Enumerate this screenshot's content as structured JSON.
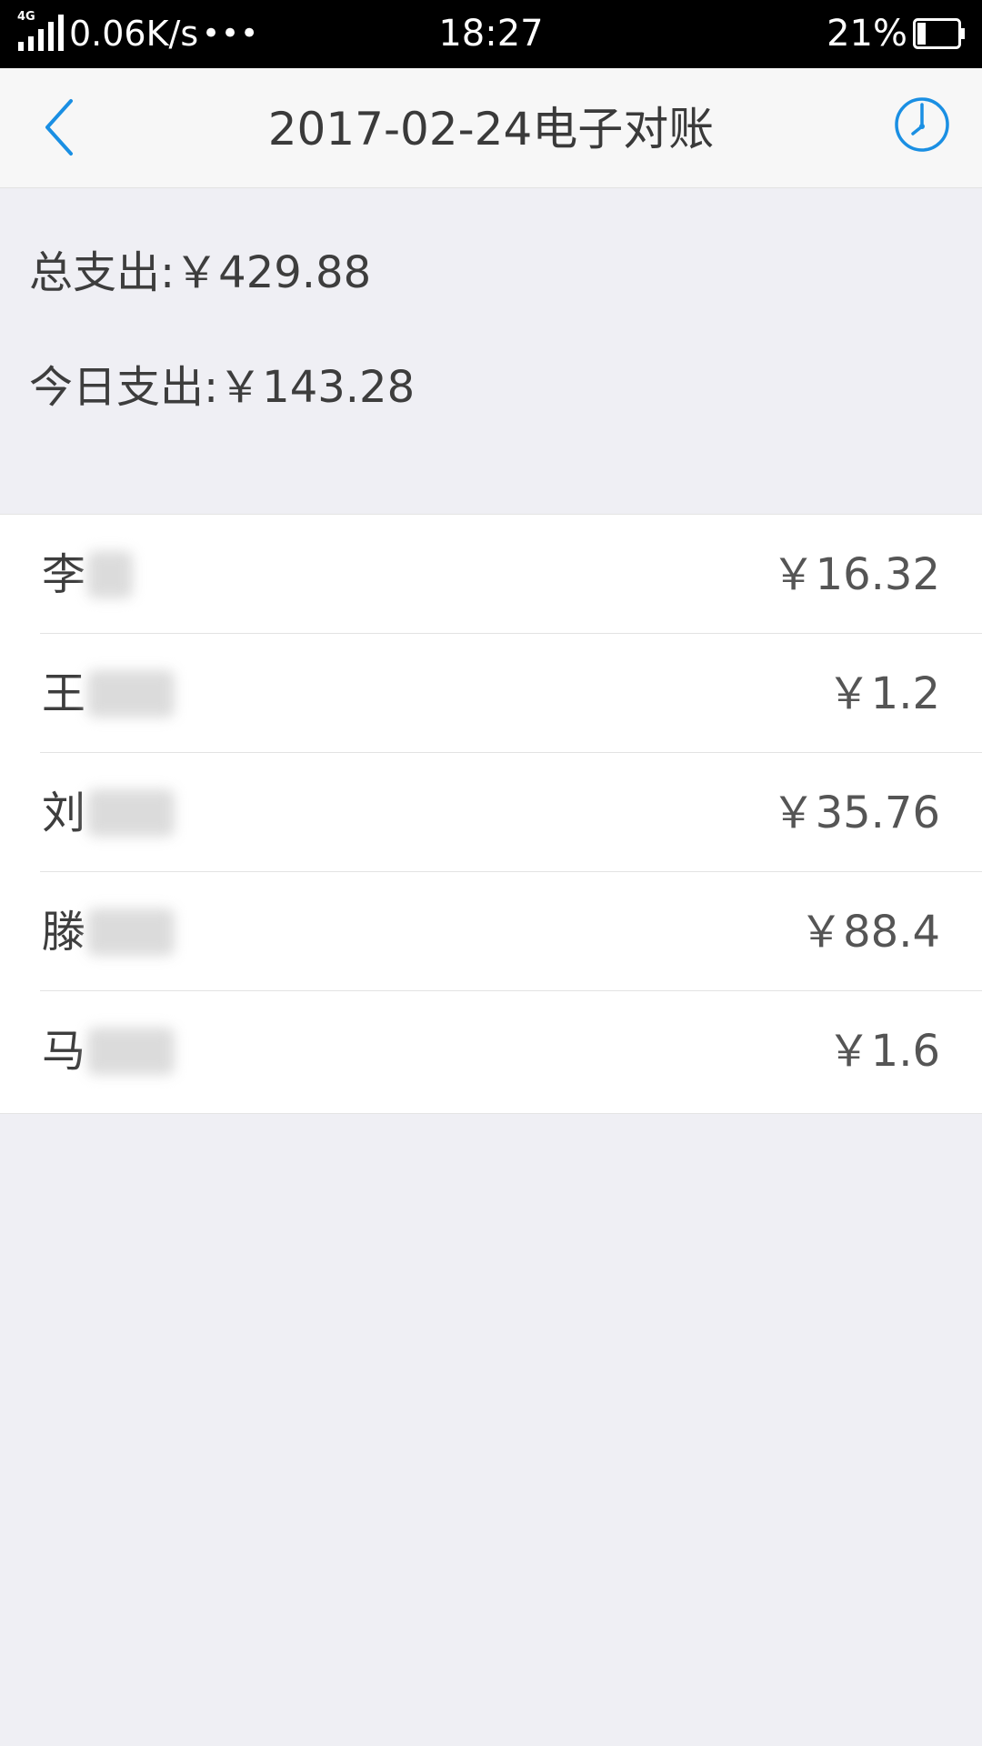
{
  "status_bar": {
    "network_label": "4G",
    "speed": "0.06K/s",
    "more": "•••",
    "time": "18:27",
    "battery": "21%",
    "battery_level": 0.21
  },
  "nav": {
    "title": "2017-02-24电子对账",
    "accent_color": "#1a8fe3"
  },
  "summary": {
    "total_expense": "总支出:￥429.88",
    "today_expense": "今日支出:￥143.28"
  },
  "records": [
    {
      "name": "李",
      "amount": "￥16.32"
    },
    {
      "name": "王",
      "amount": "￥1.2"
    },
    {
      "name": "刘",
      "amount": "￥35.76"
    },
    {
      "name": "滕",
      "amount": "￥88.4"
    },
    {
      "name": "马",
      "amount": "￥1.6"
    }
  ]
}
